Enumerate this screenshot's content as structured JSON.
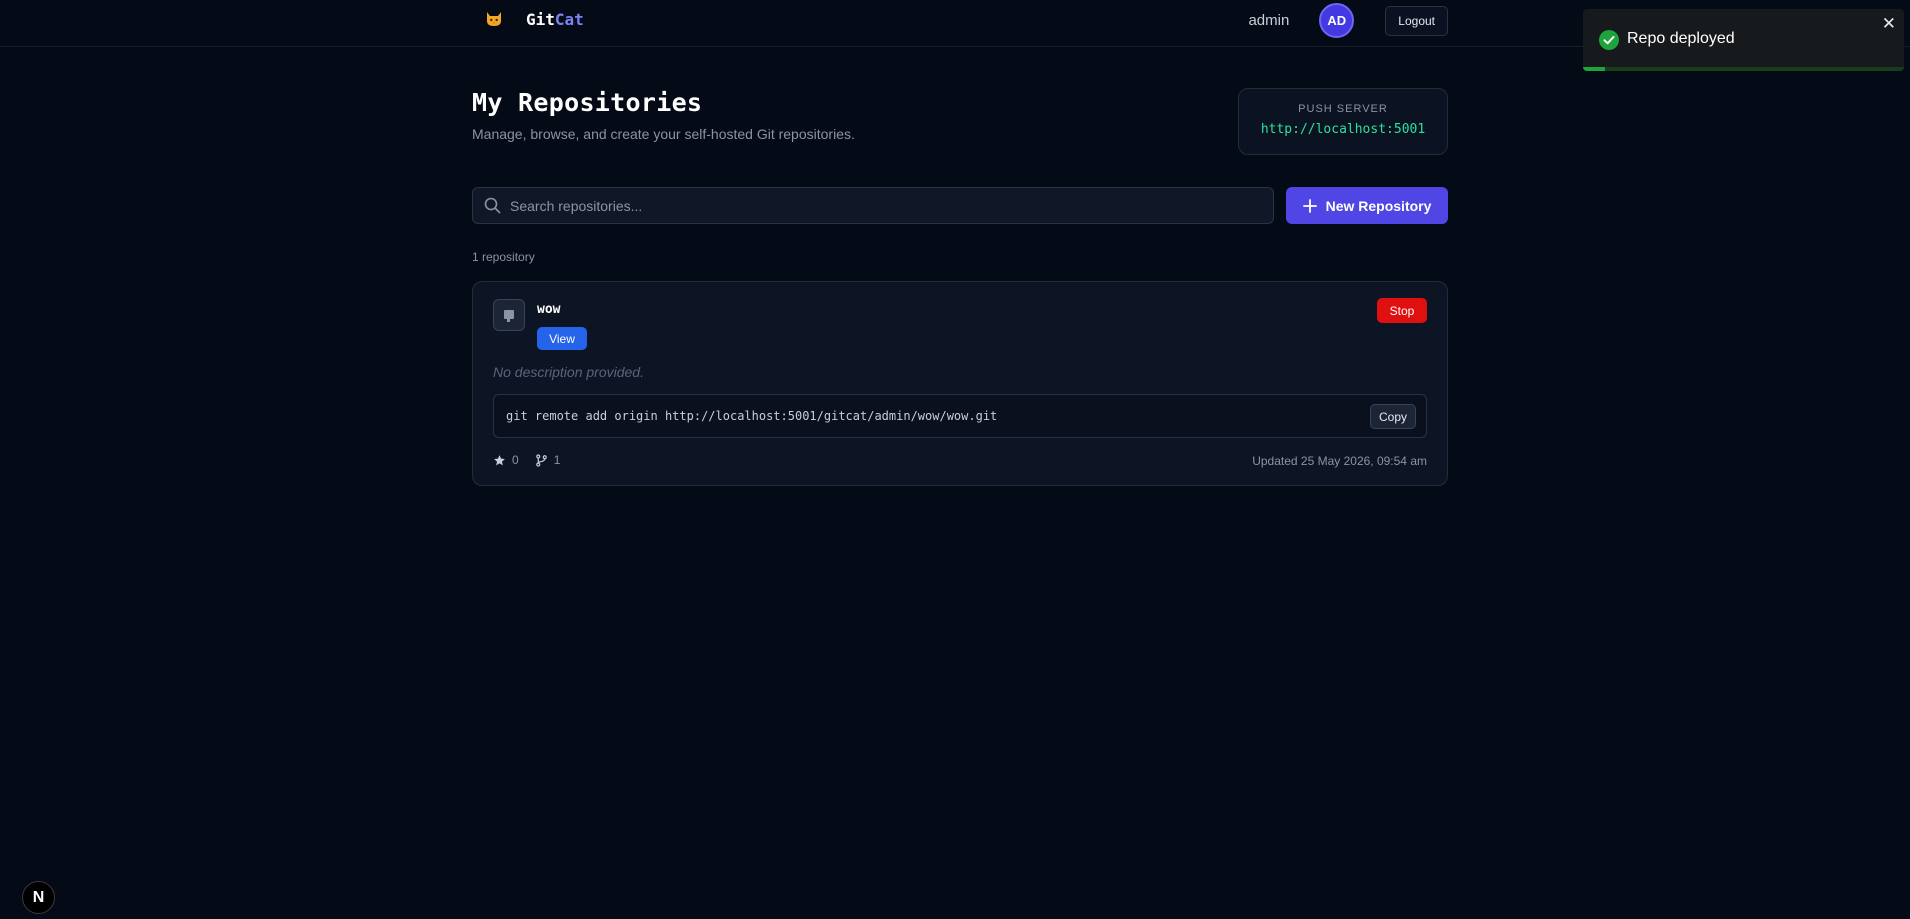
{
  "header": {
    "logo_icon": "cat-face-icon",
    "brand_main": "Git",
    "brand_accent": "Cat",
    "username": "admin",
    "avatar_initials": "AD",
    "logout_label": "Logout"
  },
  "page": {
    "title": "My Repositories",
    "subtitle": "Manage, browse, and create your self-hosted Git repositories."
  },
  "push_server": {
    "label": "PUSH SERVER",
    "url": "http://localhost:5001"
  },
  "search": {
    "placeholder": "Search repositories...",
    "value": ""
  },
  "actions": {
    "new_repo_label": "New Repository"
  },
  "repo_count": "1 repository",
  "repos": [
    {
      "name": "wow",
      "view_label": "View",
      "stop_label": "Stop",
      "description": "No description provided.",
      "clone_command": "git remote add origin http://localhost:5001/gitcat/admin/wow/wow.git",
      "copy_label": "Copy",
      "stars": "0",
      "forks": "1",
      "updated": "Updated 25 May 2026, 09:54 am"
    }
  ],
  "toast": {
    "message": "Repo deployed",
    "close_glyph": "✕",
    "progress": 0.07
  },
  "dev_badge": "N",
  "colors": {
    "background": "#050a17",
    "accent": "#4f46e5",
    "success": "#1fa33b",
    "danger": "#e01010",
    "link": "#2563eb",
    "push_url": "#2ee09a"
  }
}
